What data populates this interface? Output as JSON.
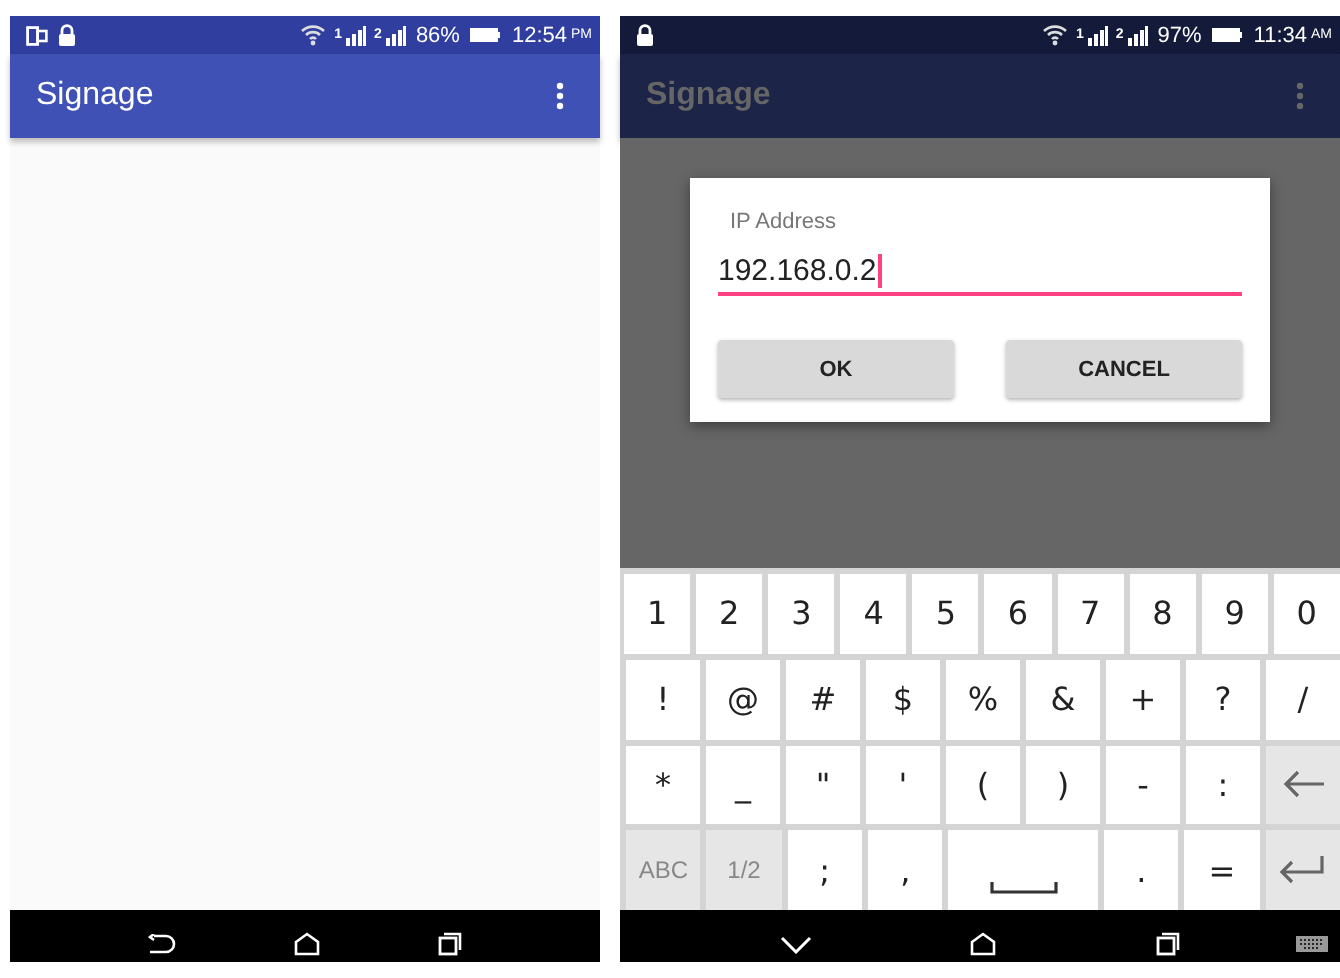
{
  "screens": [
    {
      "dimmed": false,
      "status_bar": {
        "left_icons": [
          {
            "kind": "cast"
          },
          {
            "kind": "lock"
          }
        ],
        "sims": [
          "1",
          "2"
        ],
        "battery": "86%",
        "time": "12:54",
        "meridiem": "PM"
      },
      "app_bar": {
        "title": "Signage"
      },
      "nav_bar": {
        "icons": [
          {
            "kind": "back"
          },
          {
            "kind": "home"
          },
          {
            "kind": "recents"
          }
        ]
      }
    },
    {
      "dimmed": true,
      "status_bar": {
        "left_icons": [
          {
            "kind": "lock"
          }
        ],
        "sims": [
          "1",
          "2"
        ],
        "battery": "97%",
        "time": "11:34",
        "meridiem": "AM"
      },
      "app_bar": {
        "title": "Signage"
      },
      "dialog": {
        "title": "IP Address",
        "value": "192.168.0.2",
        "buttons": [
          "OK",
          "CANCEL"
        ]
      },
      "keyboard": {
        "number_row": [
          {
            "label": "1",
            "kind": "char"
          },
          {
            "label": "2",
            "kind": "char"
          },
          {
            "label": "3",
            "kind": "char"
          },
          {
            "label": "4",
            "kind": "char"
          },
          {
            "label": "5",
            "kind": "char"
          },
          {
            "label": "6",
            "kind": "char"
          },
          {
            "label": "7",
            "kind": "char"
          },
          {
            "label": "8",
            "kind": "char"
          },
          {
            "label": "9",
            "kind": "char"
          },
          {
            "label": "0",
            "kind": "char"
          }
        ],
        "symbol_rows": [
          [
            {
              "label": "!",
              "kind": "char"
            },
            {
              "label": "@",
              "kind": "char"
            },
            {
              "label": "#",
              "kind": "char"
            },
            {
              "label": "$",
              "kind": "char"
            },
            {
              "label": "%",
              "kind": "char"
            },
            {
              "label": "&",
              "kind": "char"
            },
            {
              "label": "+",
              "kind": "char"
            },
            {
              "label": "?",
              "kind": "char"
            },
            {
              "label": "/",
              "kind": "char"
            }
          ],
          [
            {
              "label": "*",
              "kind": "char"
            },
            {
              "label": "_",
              "kind": "char"
            },
            {
              "label": "\"",
              "kind": "char"
            },
            {
              "label": "'",
              "kind": "char"
            },
            {
              "label": "(",
              "kind": "char"
            },
            {
              "label": ")",
              "kind": "char"
            },
            {
              "label": "-",
              "kind": "char"
            },
            {
              "label": ":",
              "kind": "char"
            },
            {
              "kind": "backspace"
            }
          ],
          [
            {
              "label": "ABC",
              "kind": "function"
            },
            {
              "label": "1/2",
              "kind": "function"
            },
            {
              "label": ";",
              "kind": "char"
            },
            {
              "label": ",",
              "kind": "char"
            },
            {
              "kind": "space"
            },
            {
              "label": ".",
              "kind": "char"
            },
            {
              "label": "=",
              "kind": "char"
            },
            {
              "kind": "enter"
            }
          ]
        ]
      },
      "nav_bar": {
        "icons": [
          {
            "kind": "hide_keyboard"
          },
          {
            "kind": "home"
          },
          {
            "kind": "recents"
          },
          {
            "kind": "keyboard"
          }
        ]
      }
    }
  ]
}
